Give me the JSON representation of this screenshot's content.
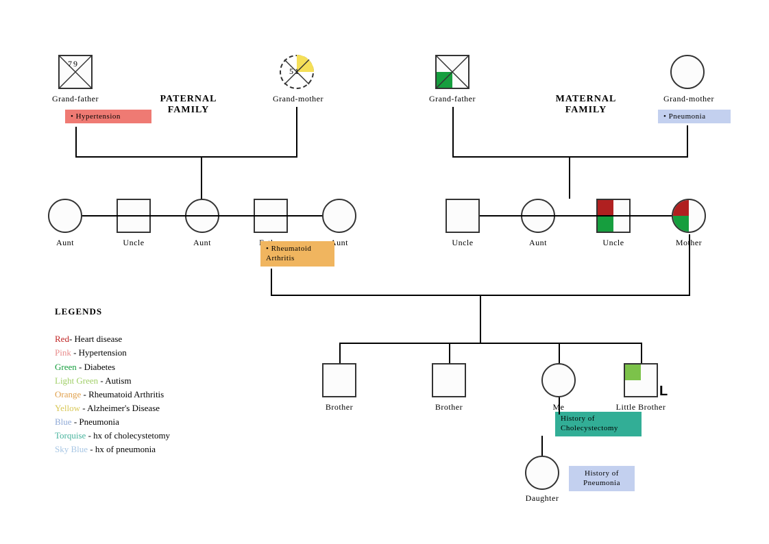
{
  "sections": {
    "paternal_label": "PATERNAL FAMILY",
    "maternal_label": "MATERNAL FAMILY",
    "legends_title": "LEGENDS"
  },
  "people": {
    "pgf": {
      "label": "Grand-father",
      "age": "79"
    },
    "pgm": {
      "label": "Grand-mother",
      "age": "51"
    },
    "mgf": {
      "label": "Grand-father"
    },
    "mgm": {
      "label": "Grand-mother"
    },
    "aunt1": {
      "label": "Aunt"
    },
    "uncle1": {
      "label": "Uncle"
    },
    "aunt2": {
      "label": "Aunt"
    },
    "father": {
      "label": "Father"
    },
    "aunt3": {
      "label": "Aunt"
    },
    "uncle2": {
      "label": "Uncle"
    },
    "aunt4": {
      "label": "Aunt"
    },
    "uncle3": {
      "label": "Uncle"
    },
    "mother": {
      "label": "Mother"
    },
    "brother1": {
      "label": "Brother"
    },
    "brother2": {
      "label": "Brother"
    },
    "me": {
      "label": "Me"
    },
    "littlebrother": {
      "label": "Little Brother"
    },
    "daughter": {
      "label": "Daughter"
    }
  },
  "notes": {
    "hypertension": "Hypertension",
    "rheumatoid": "Rheumatoid Arthritis",
    "pneumonia": "Pneumonia",
    "hx_chole": "History of Cholecystectomy",
    "hx_pneum": "History of Pneumonia"
  },
  "colors": {
    "red": "#b02020",
    "pink": "#ef7a73",
    "green": "#169e3e",
    "light_green": "#7cc24a",
    "orange": "#f0b55f",
    "yellow": "#f5df58",
    "blue": "#c3d0ef",
    "turquoise": "#32ae96",
    "sky_blue": "#aec9e6",
    "label_red": "#c02525",
    "label_pink": "#e88b8b",
    "label_green": "#169e3e",
    "label_lgreen": "#a0cf67",
    "label_orange": "#e0a04b",
    "label_yellow": "#d8c756",
    "label_blue": "#8ea8d6",
    "label_torq": "#46b39c",
    "label_sky": "#a7c6e4"
  },
  "legends": [
    {
      "color_key": "label_red",
      "name": "Red",
      "sep": "- ",
      "desc": "Heart disease"
    },
    {
      "color_key": "label_pink",
      "name": "Pink",
      "sep": " - ",
      "desc": "Hypertension"
    },
    {
      "color_key": "label_green",
      "name": "Green",
      "sep": " - ",
      "desc": "Diabetes"
    },
    {
      "color_key": "label_lgreen",
      "name": "Light Green",
      "sep": " - ",
      "desc": "Autism"
    },
    {
      "color_key": "label_orange",
      "name": "Orange",
      "sep": " - ",
      "desc": "Rheumatoid Arthritis"
    },
    {
      "color_key": "label_yellow",
      "name": "Yellow",
      "sep": " - ",
      "desc": "Alzheimer's Disease"
    },
    {
      "color_key": "label_blue",
      "name": "Blue",
      "sep": " - ",
      "desc": "Pneumonia"
    },
    {
      "color_key": "label_torq",
      "name": "Torquise",
      "sep": " - ",
      "desc": "hx of cholecystetomy"
    },
    {
      "color_key": "label_sky",
      "name": "Sky Blue",
      "sep": " - ",
      "desc": "hx of pneumonia"
    }
  ],
  "chart_data": {
    "type": "genogram",
    "generations": [
      {
        "level": 1,
        "members": [
          {
            "id": "pgf",
            "sex": "M",
            "label": "Grand-father",
            "deceased": true,
            "age": 79,
            "conditions": [
              "hypertension"
            ],
            "side": "paternal"
          },
          {
            "id": "pgm",
            "sex": "F",
            "label": "Grand-mother",
            "deceased": true,
            "age": 51,
            "conditions": [
              "alzheimers"
            ],
            "side": "paternal"
          },
          {
            "id": "mgf",
            "sex": "M",
            "label": "Grand-father",
            "deceased": true,
            "conditions": [
              "diabetes"
            ],
            "side": "maternal"
          },
          {
            "id": "mgm",
            "sex": "F",
            "label": "Grand-mother",
            "conditions": [
              "pneumonia"
            ],
            "side": "maternal"
          }
        ]
      },
      {
        "level": 2,
        "members": [
          {
            "id": "aunt1",
            "sex": "F",
            "label": "Aunt",
            "side": "paternal"
          },
          {
            "id": "uncle1",
            "sex": "M",
            "label": "Uncle",
            "side": "paternal"
          },
          {
            "id": "aunt2",
            "sex": "F",
            "label": "Aunt",
            "side": "paternal"
          },
          {
            "id": "father",
            "sex": "M",
            "label": "Father",
            "conditions": [
              "rheumatoid_arthritis"
            ],
            "side": "paternal"
          },
          {
            "id": "aunt3",
            "sex": "F",
            "label": "Aunt",
            "side": "paternal"
          },
          {
            "id": "uncle2",
            "sex": "M",
            "label": "Uncle",
            "side": "maternal"
          },
          {
            "id": "aunt4",
            "sex": "F",
            "label": "Aunt",
            "side": "maternal"
          },
          {
            "id": "uncle3",
            "sex": "M",
            "label": "Uncle",
            "conditions": [
              "heart_disease",
              "diabetes"
            ],
            "side": "maternal"
          },
          {
            "id": "mother",
            "sex": "F",
            "label": "Mother",
            "conditions": [
              "heart_disease",
              "diabetes"
            ],
            "side": "maternal"
          }
        ]
      },
      {
        "level": 3,
        "members": [
          {
            "id": "brother1",
            "sex": "M",
            "label": "Brother"
          },
          {
            "id": "brother2",
            "sex": "M",
            "label": "Brother"
          },
          {
            "id": "me",
            "sex": "F",
            "label": "Me",
            "proband": true,
            "conditions": [
              "hx_cholecystectomy",
              "hx_pneumonia"
            ]
          },
          {
            "id": "littlebrother",
            "sex": "M",
            "label": "Little Brother",
            "conditions": [
              "autism"
            ]
          }
        ]
      },
      {
        "level": 4,
        "members": [
          {
            "id": "daughter",
            "sex": "F",
            "label": "Daughter"
          }
        ]
      }
    ],
    "unions": [
      {
        "partners": [
          "pgf",
          "pgm"
        ],
        "children": [
          "aunt1",
          "uncle1",
          "aunt2",
          "father",
          "aunt3"
        ]
      },
      {
        "partners": [
          "mgf",
          "mgm"
        ],
        "children": [
          "uncle2",
          "aunt4",
          "uncle3",
          "mother"
        ]
      },
      {
        "partners": [
          "father",
          "mother"
        ],
        "children": [
          "brother1",
          "brother2",
          "me",
          "littlebrother"
        ]
      },
      {
        "partners": [
          "me"
        ],
        "children": [
          "daughter"
        ]
      }
    ],
    "condition_colors": {
      "heart_disease": "red",
      "hypertension": "pink",
      "diabetes": "green",
      "autism": "light_green",
      "rheumatoid_arthritis": "orange",
      "alzheimers": "yellow",
      "pneumonia": "blue",
      "hx_cholecystectomy": "turquoise",
      "hx_pneumonia": "sky_blue"
    }
  }
}
